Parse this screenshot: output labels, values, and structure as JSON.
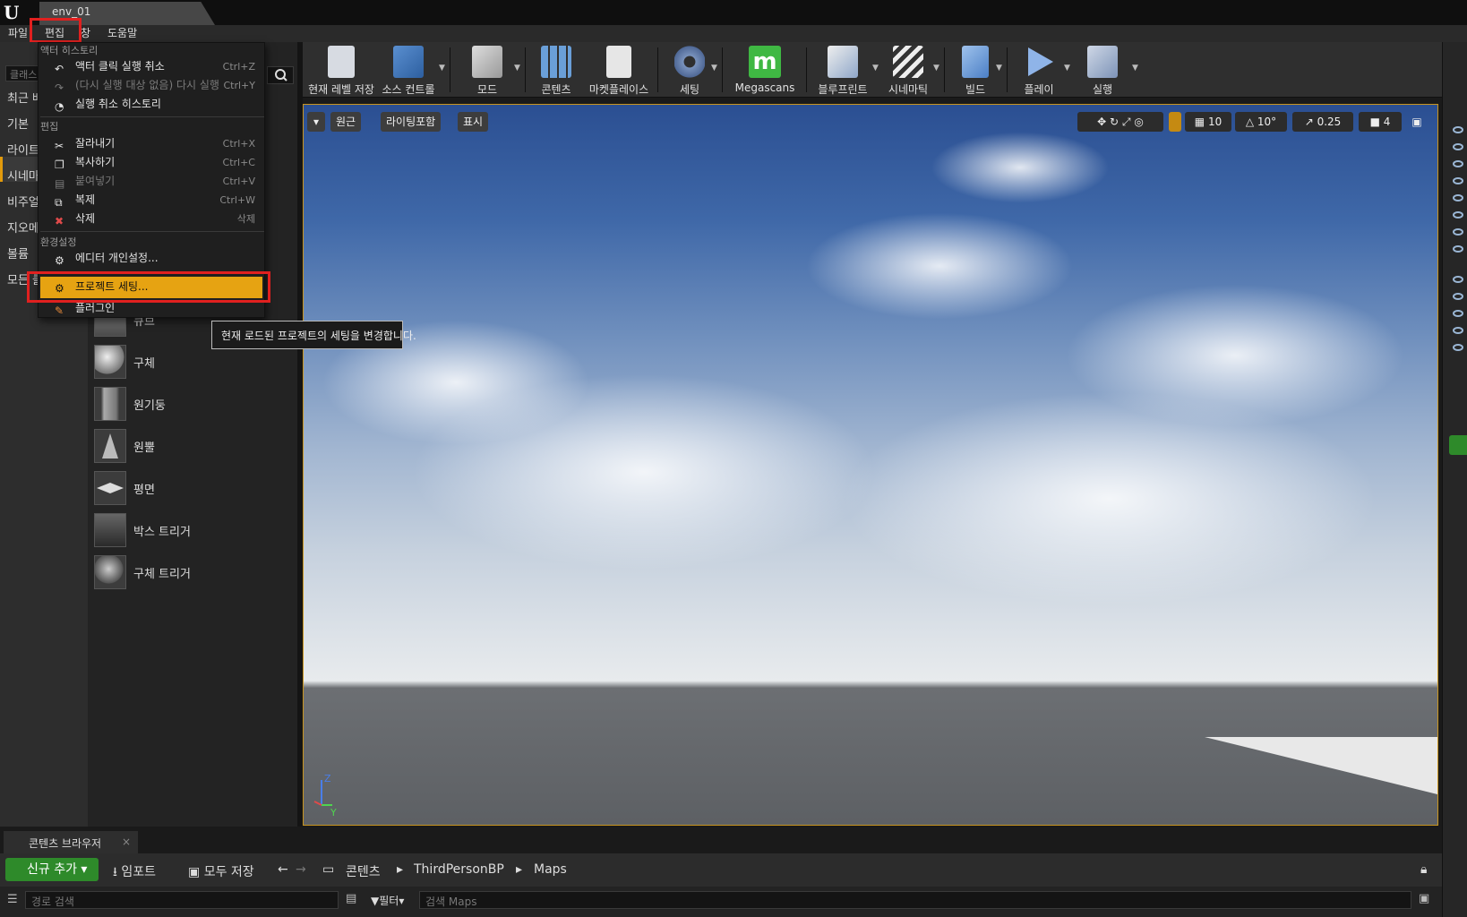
{
  "window": {
    "tab_title": "env_01"
  },
  "menubar": {
    "items": [
      "파일",
      "편집",
      "창",
      "도움말"
    ]
  },
  "left_panel": {
    "search_placeholder": "클래스",
    "categories": [
      "최근 배",
      "기본",
      "라이트",
      "시네마",
      "비주얼",
      "지오메",
      "볼륨",
      "모든 클"
    ],
    "placeables": [
      "큐브",
      "구체",
      "원기둥",
      "원뿔",
      "평면",
      "박스 트리거",
      "구체 트리거"
    ]
  },
  "edit_menu": {
    "header_top": "액터 히스토리",
    "history": [
      {
        "label": "액터 클릭 실행 취소",
        "shortcut": "Ctrl+Z"
      },
      {
        "label": "(다시 실행 대상 없음) 다시 실행",
        "shortcut": "Ctrl+Y"
      },
      {
        "label": "실행 취소 히스토리",
        "shortcut": ""
      }
    ],
    "edit_header": "편집",
    "edit": [
      {
        "label": "잘라내기",
        "shortcut": "Ctrl+X"
      },
      {
        "label": "복사하기",
        "shortcut": "Ctrl+C"
      },
      {
        "label": "붙여넣기",
        "shortcut": "Ctrl+V"
      },
      {
        "label": "복제",
        "shortcut": "Ctrl+W"
      },
      {
        "label": "삭제",
        "shortcut": "삭제"
      }
    ],
    "config_header": "환경설정",
    "config": [
      {
        "label": "에디터 개인설정..."
      },
      {
        "label": "프로젝트 세팅..."
      },
      {
        "label": "플러그인"
      }
    ]
  },
  "tooltip": "현재 로드된 프로젝트의 세팅을 변경합니다.",
  "toolbar": {
    "buttons": [
      "현재 레벨 저장",
      "소스 컨트롤",
      "모드",
      "콘텐츠",
      "마켓플레이스",
      "세팅",
      "Megascans",
      "블루프린트",
      "시네마틱",
      "빌드",
      "플레이",
      "실행"
    ]
  },
  "viewport": {
    "perspective": "원근",
    "lighting": "라이팅포함",
    "show": "표시",
    "grid_snap": "10",
    "rotation_snap": "10°",
    "scale_snap": "0.25",
    "camera_speed": "4",
    "axis_z": "Z",
    "axis_y": "Y"
  },
  "content_browser": {
    "tab_label": "콘텐츠 브라우저",
    "add_new": "신규 추가",
    "import": "임포트",
    "save_all": "모두 저장",
    "path": [
      "콘텐츠",
      "ThirdPersonBP",
      "Maps"
    ],
    "path_search_placeholder": "경로 검색",
    "filter": "필터",
    "asset_search_placeholder": "검색 Maps"
  },
  "colors": {
    "accent": "#e6a312",
    "highlight_box": "#e0201f",
    "add_button": "#2e8a2a",
    "viewport_border": "#c9951f"
  }
}
